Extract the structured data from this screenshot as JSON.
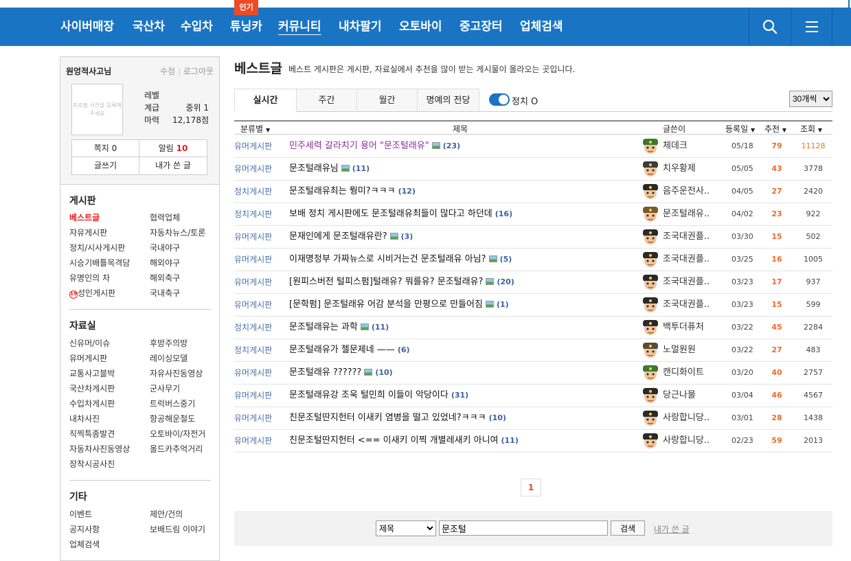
{
  "nav": {
    "items": [
      "사이버매장",
      "국산차",
      "수입차",
      "튜닝카",
      "커뮤니티",
      "내차팔기",
      "오토바이",
      "중고장터",
      "업체검색"
    ],
    "badge": "인기",
    "search_icon": "search-icon",
    "menu_icon": "hamburger-menu-icon",
    "color": "#1a74c4"
  },
  "user": {
    "name": "원엉적사고님",
    "edit": "수정",
    "logout": "로그아웃",
    "photo_placeholder": "프로필 사진을 등록해주세요",
    "level_label": "레벨",
    "rank_label": "계급",
    "rank_value": "중위 1",
    "points_label": "마력",
    "points_value": "12,178점",
    "buttons": {
      "notes": "쪽지 0",
      "alerts_label": "알림",
      "alerts_count": "10",
      "write": "글쓰기",
      "my_posts": "내가 쓴 글"
    }
  },
  "sidebar": {
    "board_title": "게시판",
    "board_left": [
      "베스트글",
      "자유게시판",
      "정치/시사게시판",
      "시승기배틀목격담",
      "유명인의 차",
      "성인게시판"
    ],
    "board_right": [
      "협력업체",
      "자동차뉴스/토론",
      "국내야구",
      "해외야구",
      "해외축구",
      "국내축구"
    ],
    "adult_badge": "19",
    "data_title": "자료실",
    "data_left": [
      "신유머/이슈",
      "유머게시판",
      "교통사고블박",
      "국산차게시판",
      "수입차게시판",
      "내차사진",
      "직찍특종발견",
      "자동차사진동영상",
      "장착시공사진"
    ],
    "data_right": [
      "후방주의방",
      "레이싱모델",
      "자유사진동영상",
      "군사무기",
      "트럭버스중기",
      "항공해운철도",
      "오토바이/자전거",
      "올드카추억거리"
    ],
    "etc_title": "기타",
    "etc_left": [
      "이벤트",
      "공지사항",
      "업체검색"
    ],
    "etc_right": [
      "제안/건의",
      "보배드림 이야기"
    ]
  },
  "main": {
    "title": "베스트글",
    "description": "베스트 게시판은 게시판, 자료실에서 추천을 많이 받는 게시물이 올라오는 곳입니다.",
    "tabs": [
      "실시간",
      "주간",
      "월간",
      "명예의 전당"
    ],
    "toggle_label": "정치 O",
    "count_option": "30개씩",
    "columns": {
      "category": "분류별",
      "title": "제목",
      "author": "글쓴이",
      "date": "등록일",
      "recommend": "추천",
      "views": "조회"
    }
  },
  "posts": [
    {
      "category": "유머게시판",
      "title": "민주세력 갈라치기 용어 \"문조털래유\"",
      "has_image": true,
      "comments": "(23)",
      "author": "체데크",
      "date": "05/18",
      "recommend": "79",
      "views": "11128",
      "hot": true,
      "avatar_color": "#3a7a2c"
    },
    {
      "category": "유머게시판",
      "title": "문조털래유님",
      "has_image": true,
      "comments": "(11)",
      "author": "치우황제",
      "date": "05/05",
      "recommend": "43",
      "views": "3778",
      "hot": false,
      "avatar_color": "#3b3b3b"
    },
    {
      "category": "정치게시판",
      "title": "문조털래유최는 뭥미?ㅋㅋㅋ",
      "has_image": false,
      "comments": "(12)",
      "author": "음주운전사..",
      "date": "04/05",
      "recommend": "27",
      "views": "2420",
      "hot": false,
      "avatar_color": "#2a2a2a"
    },
    {
      "category": "정치게시판",
      "title": "보배 정치 게시판에도 문조털래유최들이 많다고 하던데",
      "has_image": false,
      "comments": "(16)",
      "author": "문조털래유..",
      "date": "04/02",
      "recommend": "23",
      "views": "922",
      "hot": false,
      "avatar_color": "#7a5a2a"
    },
    {
      "category": "유머게시판",
      "title": "문재인에게 문조털래유란?",
      "has_image": true,
      "comments": "(3)",
      "author": "조국대권플..",
      "date": "03/30",
      "recommend": "15",
      "views": "502",
      "hot": false,
      "avatar_color": "#2a2a2a"
    },
    {
      "category": "유머게시판",
      "title": "이재명정부 가짜뉴스로 시비거는건 문조털래유 아님?",
      "has_image": true,
      "comments": "(5)",
      "author": "조국대권플..",
      "date": "03/25",
      "recommend": "16",
      "views": "1005",
      "hot": false,
      "avatar_color": "#2a2a2a"
    },
    {
      "category": "유머게시판",
      "title": "[원피스버전 털피스펌]털래유? 뭐를유? 문조털래유?",
      "has_image": true,
      "comments": "(20)",
      "author": "조국대권플..",
      "date": "03/23",
      "recommend": "17",
      "views": "937",
      "hot": false,
      "avatar_color": "#2a2a2a"
    },
    {
      "category": "유머게시판",
      "title": "[문학펌] 문조털래유 어감 분석을 만평으로 만들어짐",
      "has_image": true,
      "comments": "(1)",
      "author": "조국대권플..",
      "date": "03/23",
      "recommend": "15",
      "views": "599",
      "hot": false,
      "avatar_color": "#2a2a2a"
    },
    {
      "category": "정치게시판",
      "title": "문조털래유는 과학",
      "has_image": true,
      "comments": "(11)",
      "author": "백투더퓨처",
      "date": "03/22",
      "recommend": "45",
      "views": "2284",
      "hot": false,
      "avatar_color": "#2a2a2a"
    },
    {
      "category": "정치게시판",
      "title": "문조털래유가 젤문제네 ——",
      "has_image": false,
      "comments": "(6)",
      "author": "노멀원원",
      "date": "03/22",
      "recommend": "27",
      "views": "483",
      "hot": false,
      "avatar_color": "#5a4a3a"
    },
    {
      "category": "유머게시판",
      "title": "문조털래유 ??????",
      "has_image": true,
      "comments": "(10)",
      "author": "캔디화이트",
      "date": "03/20",
      "recommend": "40",
      "views": "2757",
      "hot": false,
      "avatar_color": "#3a7a2c"
    },
    {
      "category": "유머게시판",
      "title": "문조털래유강 조욱 털민희 이들이 악당이다",
      "has_image": false,
      "comments": "(31)",
      "author": "당근나물",
      "date": "03/04",
      "recommend": "46",
      "views": "4567",
      "hot": false,
      "avatar_color": "#2a2a2a"
    },
    {
      "category": "유머게시판",
      "title": "친문조털딴지헌터 이새키 염병을 떨고 있었네?ㅋㅋㅋ",
      "has_image": false,
      "comments": "(10)",
      "author": "사랑합니당..",
      "date": "03/01",
      "recommend": "28",
      "views": "1438",
      "hot": false,
      "avatar_color": "#2a2a2a"
    },
    {
      "category": "유머게시판",
      "title": "친문조털딴지헌터 <== 이새키 이찍 개별레새키 아니여",
      "has_image": false,
      "comments": "(11)",
      "author": "사랑합니당..",
      "date": "02/23",
      "recommend": "59",
      "views": "2013",
      "hot": false,
      "avatar_color": "#2a2a2a"
    }
  ],
  "pagination": {
    "current": "1"
  },
  "search": {
    "type_option": "제목",
    "query": "문조털",
    "button": "검색",
    "my_posts": "내가 쓴 글"
  }
}
